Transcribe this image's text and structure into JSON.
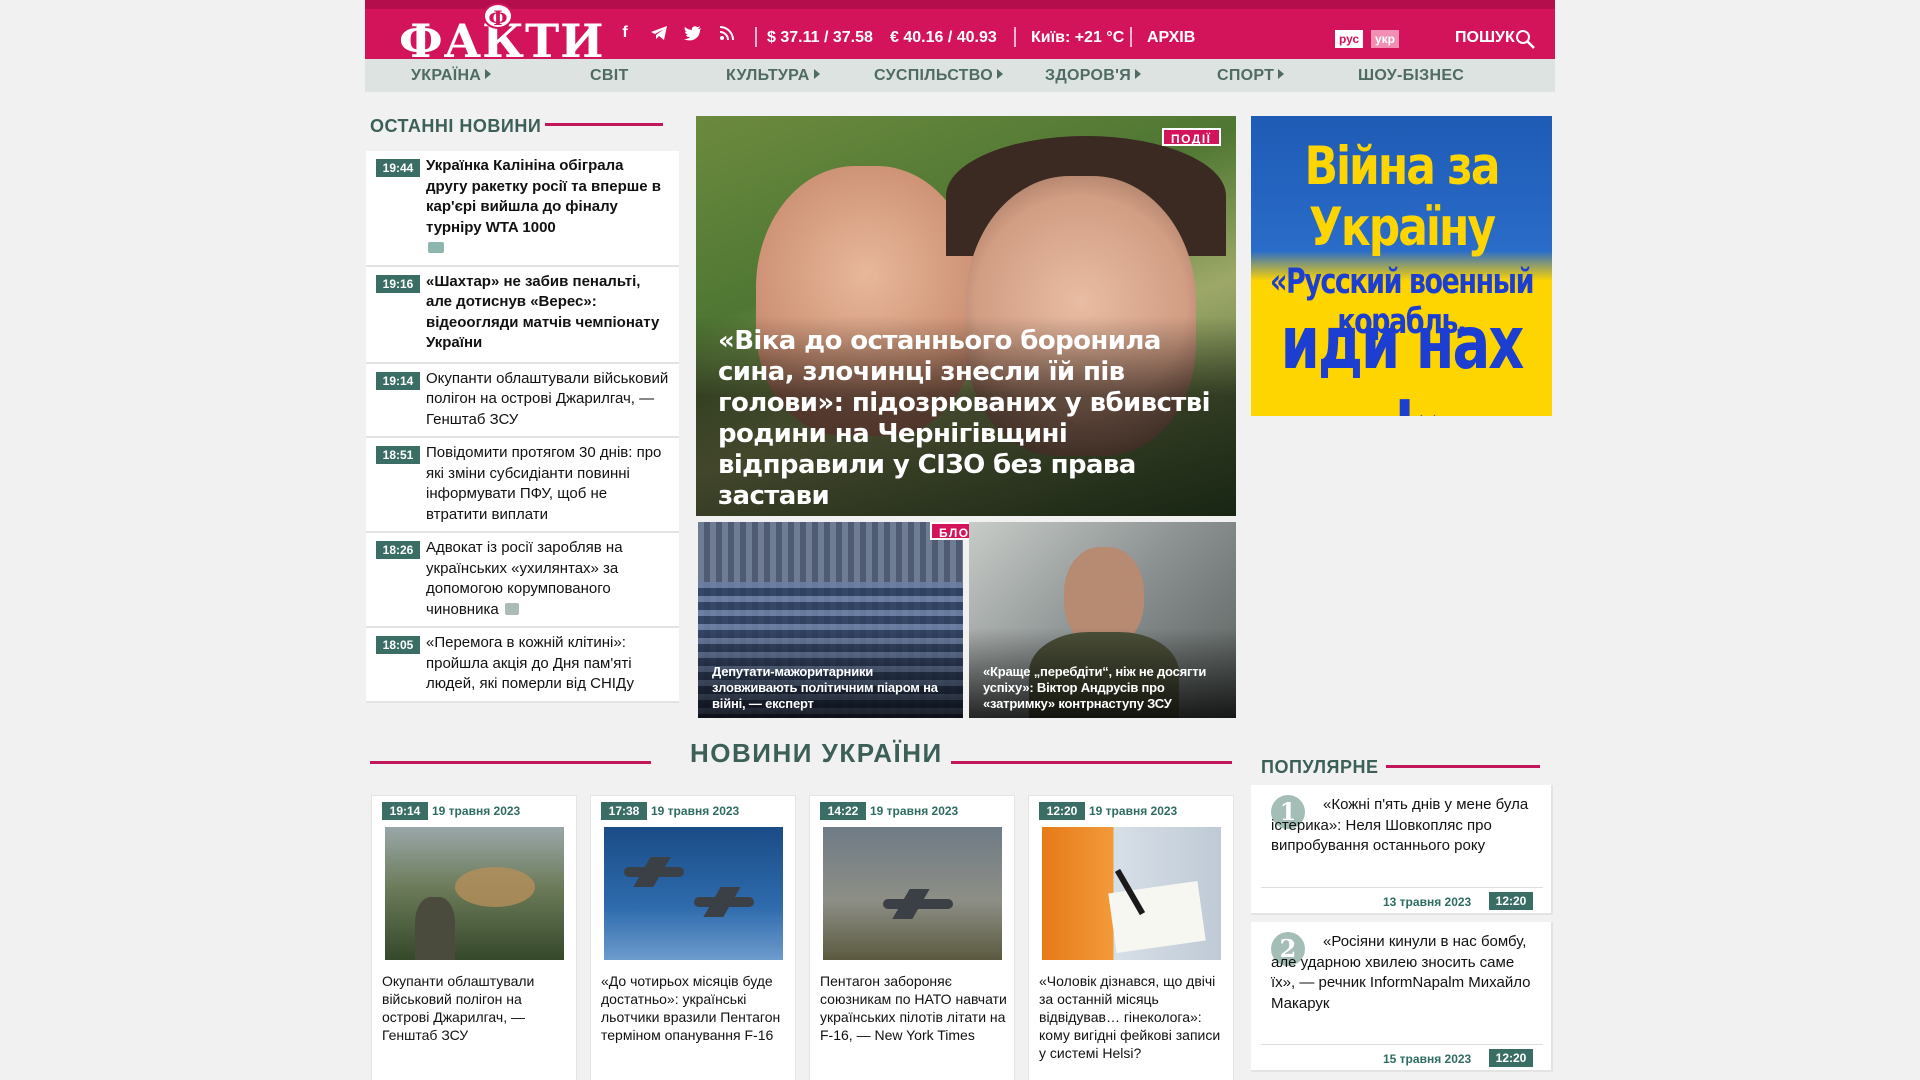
{
  "header": {
    "logo_text": "ФАКТИ",
    "logo_badge": "Ф",
    "usd_rate": "$ 37.11 / 37.58",
    "eur_rate": "€ 40.16 / 40.93",
    "weather": "Київ: +21 °C",
    "archive": "АРХІВ",
    "lang_ru": "рус",
    "lang_uk": "укр",
    "search": "ПОШУК",
    "social_icons": [
      "facebook-icon",
      "telegram-icon",
      "twitter-icon",
      "rss-icon"
    ]
  },
  "nav": [
    {
      "label": "УКРАЇНА",
      "has_arrow": true
    },
    {
      "label": "СВІТ",
      "has_arrow": false
    },
    {
      "label": "КУЛЬТУРА",
      "has_arrow": true
    },
    {
      "label": "СУСПІЛЬСТВО",
      "has_arrow": true
    },
    {
      "label": "ЗДОРОВ'Я",
      "has_arrow": true
    },
    {
      "label": "СПОРТ",
      "has_arrow": true
    },
    {
      "label": "ШОУ-БІЗНЕС",
      "has_arrow": false
    }
  ],
  "latest": {
    "title": "ОСТАННІ НОВИНИ",
    "items": [
      {
        "time": "19:44",
        "text": "Українка Калініна обіграла другу ракетку росії та вперше в кар'єрі вийшла до фіналу турніру WTA 1000",
        "bold": true,
        "icon": "video-icon"
      },
      {
        "time": "19:16",
        "text": "«Шахтар» не забив пенальті, але дотиснув «Верес»: відеоогляди матчів чемпіонату України",
        "bold": true,
        "icon": ""
      },
      {
        "time": "19:14",
        "text": "Окупанти облаштували військовий полігон на острові Джарилгач, — Генштаб ЗСУ",
        "bold": false,
        "icon": ""
      },
      {
        "time": "18:51",
        "text": "Повідомити протягом 30 днів: про які зміни субсидіанти повинні інформувати ПФУ, щоб не втратити виплати",
        "bold": false,
        "icon": ""
      },
      {
        "time": "18:26",
        "text": "Адвокат із росії заробляв на українських «ухилянтах» за допомогою корумпованого чиновника",
        "bold": false,
        "icon": "camera-icon"
      },
      {
        "time": "18:05",
        "text": "«Перемога в кожній клітині»: пройшла акція до Дня пам'яті людей, які померли від СНІДу",
        "bold": false,
        "icon": ""
      }
    ]
  },
  "hero": {
    "tag": "ПОДІЇ",
    "headline": "«Віка до останнього боронила сина, злочинці знесли їй пів голови»: підозрюваних у вбивстві родини на Чернігівщині відправили у СІЗО без права застави"
  },
  "sub_stories": [
    {
      "tag": "",
      "caption": "Депутати-мажоритарники зловживають політичним піаром на війні, — експерт"
    },
    {
      "tag": "БЛОГИ",
      "caption": "«Краще „перебдіти“, ніж не досягти успіху»: Віктор Андрусів про «затримку» контрнаступу ЗСУ"
    }
  ],
  "ad": {
    "line1": "Війна за Україну",
    "line2": "«Русский военный корабль,",
    "line3": "иди нах ..!»"
  },
  "ukraine_news": {
    "title": "НОВИНИ УКРАЇНИ",
    "cards": [
      {
        "time": "19:14",
        "date": "19 травня 2023",
        "text": "Окупанти облаштували військовий полігон на острові Джарилгач, — Генштаб ЗСУ"
      },
      {
        "time": "17:38",
        "date": "19 травня 2023",
        "text": "«До чотирьох місяців буде достатньо»: українські льотчики вразили Пентагон терміном опанування F-16"
      },
      {
        "time": "14:22",
        "date": "19 травня 2023",
        "text": "Пентагон забороняє союзникам по НАТО навчати українських пілотів літати на F-16, — New York Times"
      },
      {
        "time": "12:20",
        "date": "19 травня 2023",
        "text": "«Чоловік дізнався, що двічі за останній місяць відвідував… гінеколога»: кому вигідні фейкові записи у системі Helsi?"
      }
    ]
  },
  "popular": {
    "title": "ПОПУЛЯРНЕ",
    "items": [
      {
        "num": "1",
        "text": "«Кожні п'ять днів у мене була істерика»: Неля Шовкопляс про випробування останнього року",
        "date": "13 травня 2023",
        "time": "12:20"
      },
      {
        "num": "2",
        "text": "«Росіяни кинули в нас бомбу, але ударною хвилею зносить саме їх», — речник InformNapalm Михайло Макарук",
        "date": "15 травня 2023",
        "time": "12:20"
      }
    ]
  },
  "colors": {
    "brand": "#d4145a",
    "accent_green": "#3a6e65",
    "nav_bg": "#dde3e0"
  }
}
